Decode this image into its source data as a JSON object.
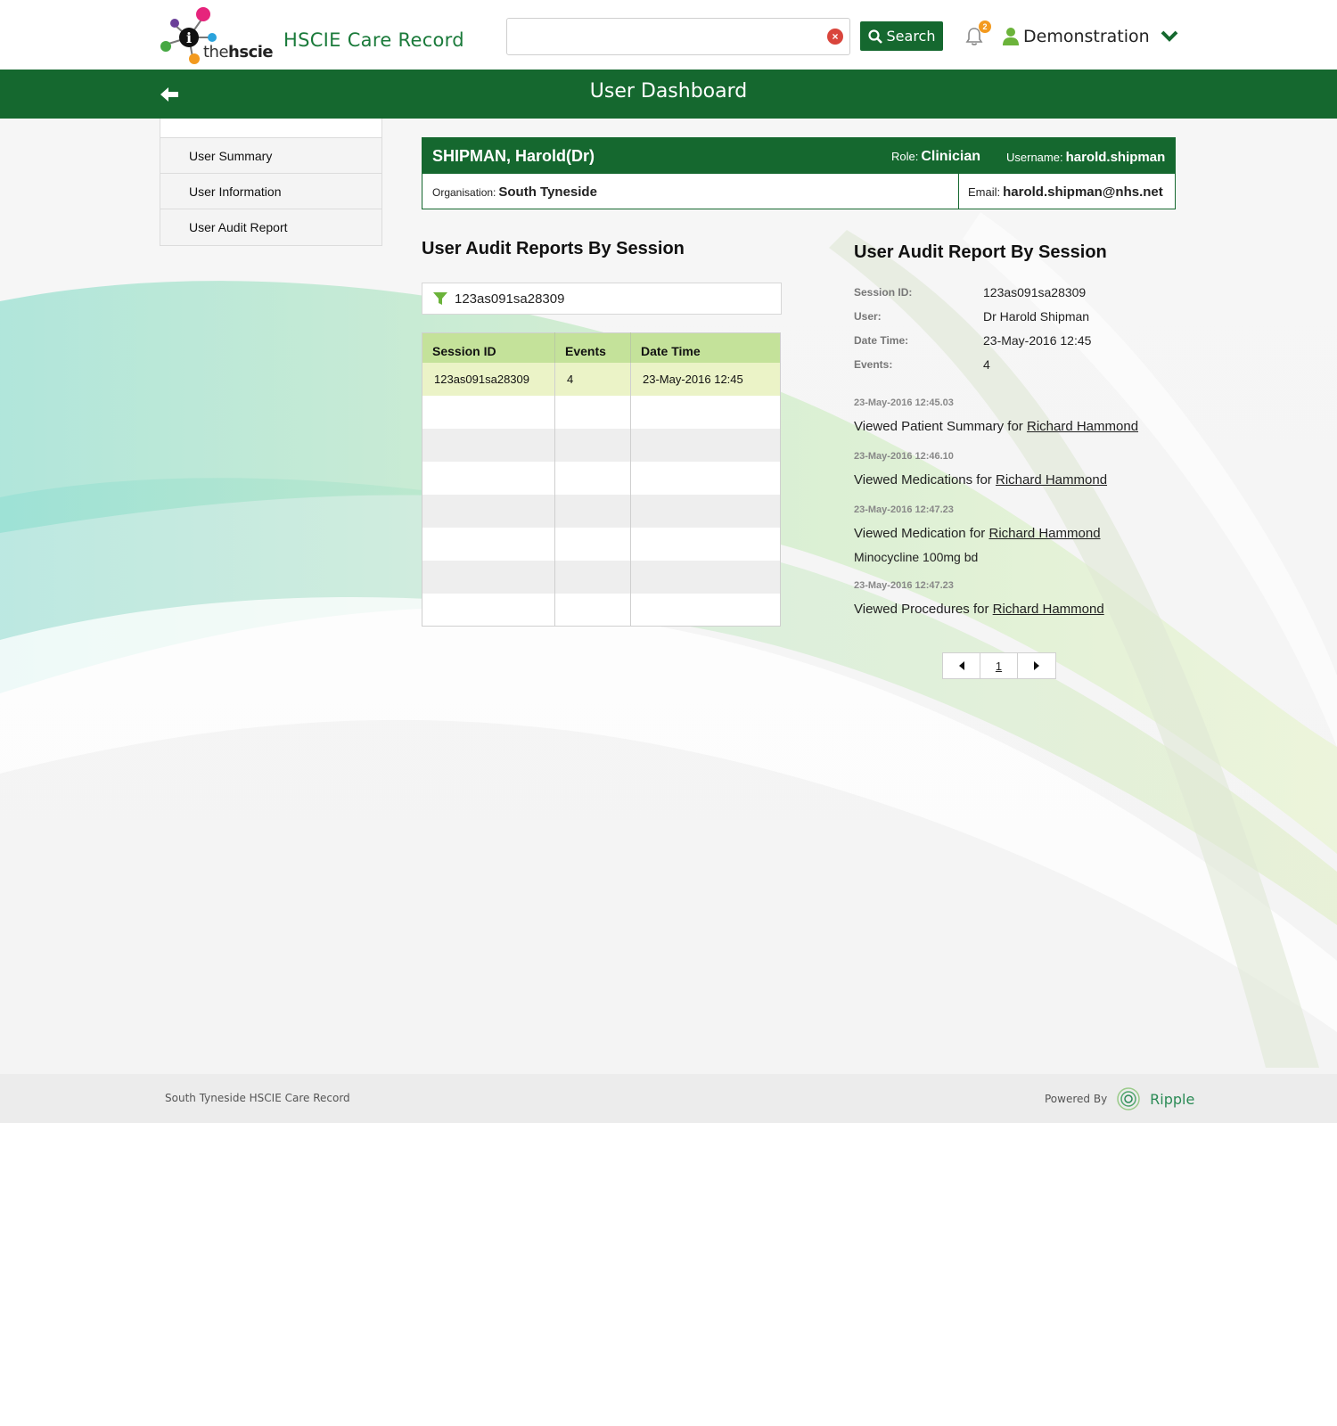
{
  "header": {
    "logo_text_prefix": "the",
    "logo_text_bold": "hscie",
    "app_title": "HSCIE Care Record",
    "search": {
      "value": "",
      "placeholder": "",
      "button_label": "Search"
    },
    "notifications_count": "2",
    "user_name": "Demonstration"
  },
  "titlebar": {
    "title": "User Dashboard"
  },
  "sidebar": {
    "items": [
      {
        "label": "User Summary"
      },
      {
        "label": "User Information"
      },
      {
        "label": "User Audit Report"
      }
    ]
  },
  "user_card": {
    "name": "SHIPMAN, Harold(Dr)",
    "role_label": "Role:",
    "role_value": "Clinician",
    "username_label": "Username:",
    "username_value": "harold.shipman",
    "org_label": "Organisation:",
    "org_value": "South Tyneside",
    "email_label": "Email:",
    "email_value": "harold.shipman@nhs.net"
  },
  "sessions": {
    "title": "User Audit Reports By Session",
    "filter_value": "123as091sa28309",
    "columns": [
      "Session ID",
      "Events",
      "Date Time"
    ],
    "rows": [
      {
        "session_id": "123as091sa28309",
        "events": "4",
        "date_time": "23-May-2016 12:45"
      }
    ]
  },
  "detail": {
    "title": "User Audit Report By Session",
    "fields": [
      {
        "label": "Session ID:",
        "value": "123as091sa28309"
      },
      {
        "label": "User:",
        "value": "Dr Harold Shipman"
      },
      {
        "label": "Date Time:",
        "value": "23-May-2016 12:45"
      },
      {
        "label": "Events:",
        "value": "4"
      }
    ],
    "events": [
      {
        "time": "23-May-2016 12:45.03",
        "text": "Viewed Patient Summary for",
        "link": "Richard Hammond",
        "extra": ""
      },
      {
        "time": "23-May-2016 12:46.10",
        "text": "Viewed Medications for",
        "link": "Richard Hammond",
        "extra": ""
      },
      {
        "time": "23-May-2016 12:47.23",
        "text": "Viewed Medication for",
        "link": "Richard Hammond",
        "extra": "Minocycline 100mg bd"
      },
      {
        "time": "23-May-2016 12:47.23",
        "text": "Viewed Procedures for",
        "link": "Richard Hammond",
        "extra": ""
      }
    ],
    "pagination": {
      "current_page": "1"
    }
  },
  "footer": {
    "left_text": "South Tyneside HSCIE Care Record",
    "powered_by": "Powered By",
    "brand": "Ripple"
  },
  "colors": {
    "primary_green": "#15682f",
    "table_header": "#c4e29a",
    "selected_row": "#ebf3c7"
  }
}
